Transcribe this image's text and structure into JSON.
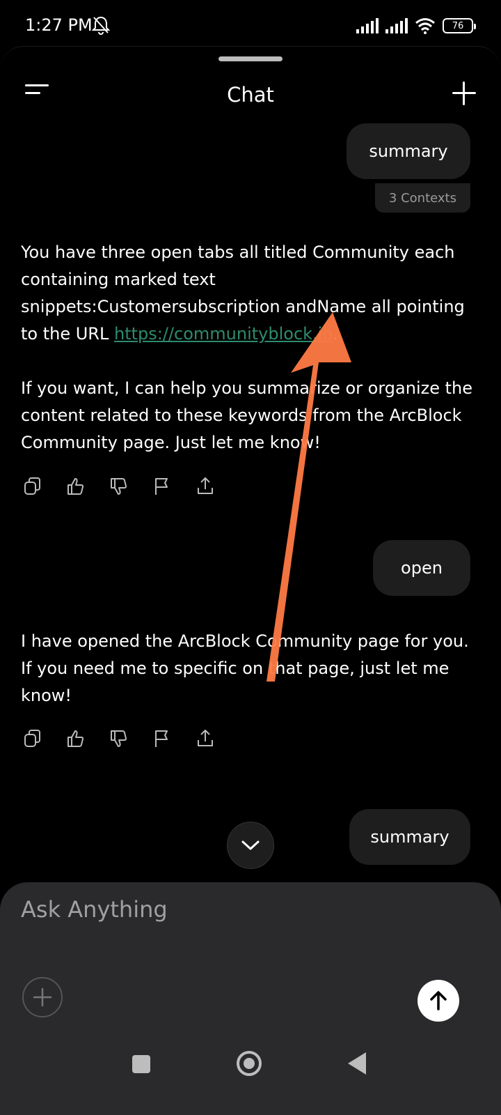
{
  "status": {
    "time": "1:27 PM",
    "battery": "76"
  },
  "header": {
    "title": "Chat"
  },
  "messages": [
    {
      "role": "user",
      "text": "summary",
      "contexts": "3 Contexts"
    },
    {
      "role": "assistant",
      "paragraphs": [
        "You have three open tabs all titled Community each containing marked text snippets:Customersubscription andName all pointing to the URL",
        "If you want, I can help you summarize or organize the content related to these keywords from the ArcBlock Community page. Just let me know!"
      ],
      "link": "https://communityblock.io",
      "link_suffix": "."
    },
    {
      "role": "user",
      "text": "open"
    },
    {
      "role": "assistant",
      "paragraphs": [
        "I have opened the ArcBlock Community page for you. If you need me to specific on that page, just let me know!"
      ]
    },
    {
      "role": "user",
      "text": "summary"
    }
  ],
  "composer": {
    "placeholder": "Ask Anything"
  },
  "icons": {
    "menu": "menu-icon",
    "new": "plus-icon",
    "copy": "copy-icon",
    "like": "thumbs-up-icon",
    "dislike": "thumbs-down-icon",
    "flag": "flag-icon",
    "share": "share-icon",
    "scroll": "chevron-down-icon",
    "attach": "plus-icon",
    "send": "arrow-up-icon"
  },
  "colors": {
    "link": "#2e8b6e",
    "annotation_arrow": "#ff7a45",
    "bubble": "#1e1e1e",
    "composer": "#2a2a2c"
  }
}
